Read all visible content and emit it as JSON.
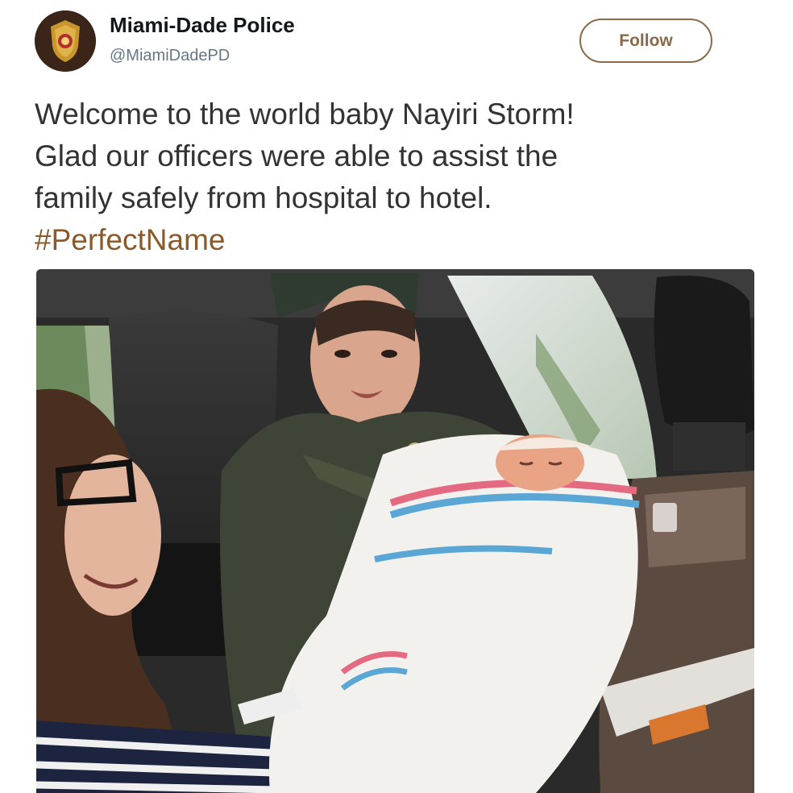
{
  "tweet": {
    "author": {
      "name": "Miami-Dade Police",
      "handle": "@MiamiDadePD",
      "avatar_icon": "police-badge-icon"
    },
    "follow_label": "Follow",
    "text_lines": [
      "Welcome to the world baby Nayiri Storm!",
      "Glad our officers were able to assist the",
      "family safely from hospital to hotel."
    ],
    "hashtag": "#PerfectName",
    "colors": {
      "accent": "#8a6a4a",
      "hashtag": "#8b5a2b",
      "text": "#333333"
    }
  }
}
